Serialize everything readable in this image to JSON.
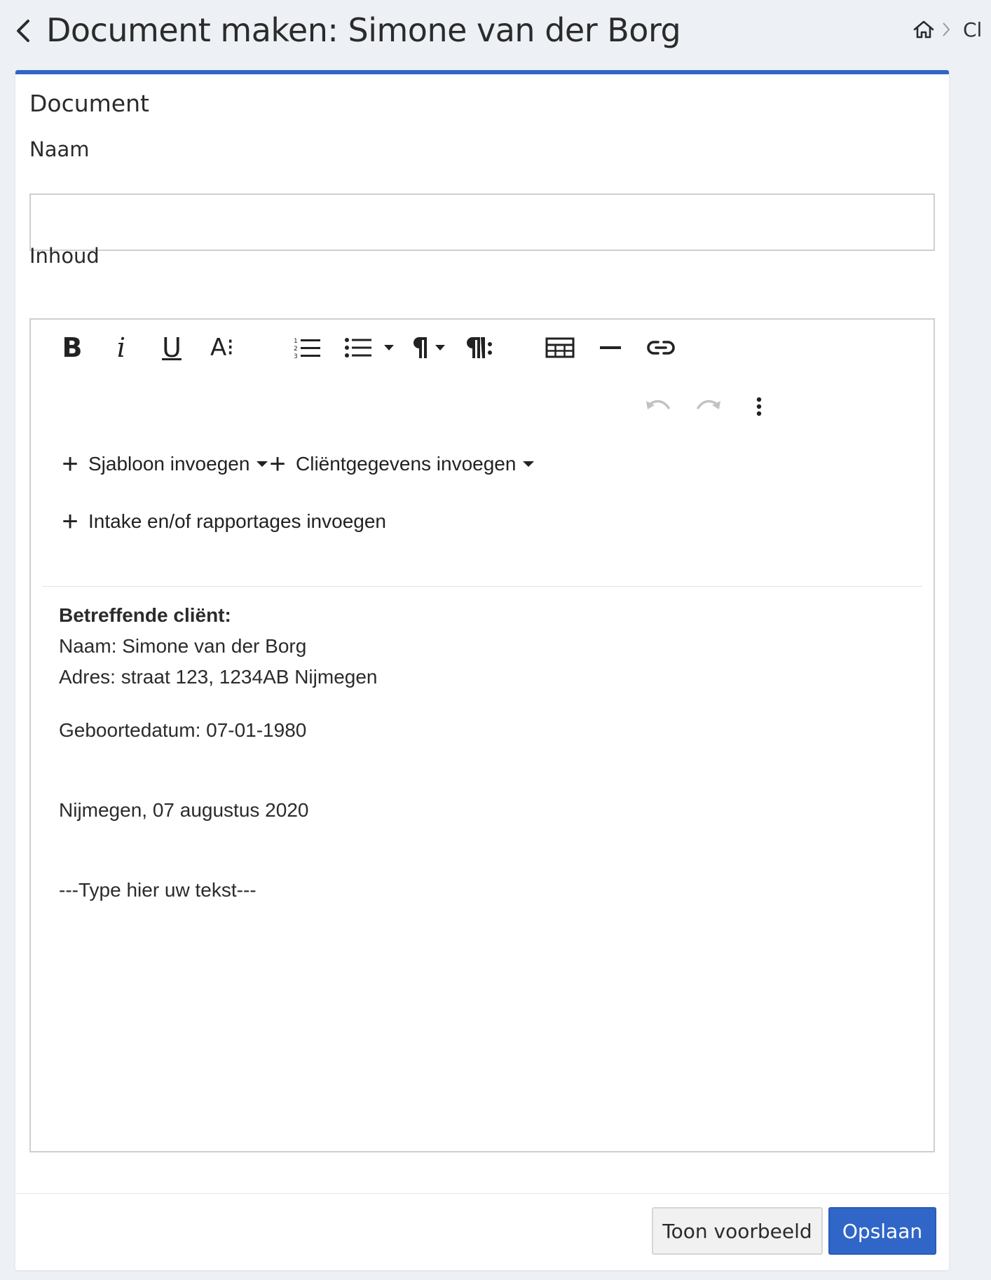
{
  "header": {
    "title": "Document maken: Simone van der Borg",
    "breadcrumb_item": "Cl"
  },
  "card": {
    "title": "Document",
    "name_label": "Naam",
    "name_value": "",
    "content_label": "Inhoud"
  },
  "toolbar": {
    "bold": "B",
    "italic": "i",
    "underline": "U",
    "font_size": "A⁝",
    "insert_template": "Sjabloon invoegen",
    "insert_client_data": "Cliëntgegevens invoegen",
    "insert_intake": "Intake en/of rapportages invoegen"
  },
  "document": {
    "heading": "Betreffende cliënt:",
    "line_name": "Naam: Simone van der Borg",
    "line_address": "Adres: straat 123, 1234AB Nijmegen",
    "line_birthdate": "Geboortedatum: 07-01-1980",
    "line_place_date": "Nijmegen, 07 augustus 2020",
    "line_placeholder": "---Type hier uw tekst---"
  },
  "footer": {
    "preview_label": "Toon voorbeeld",
    "save_label": "Opslaan"
  },
  "colors": {
    "accent": "#2f66c7",
    "background": "#edf0f5"
  },
  "icons": [
    "chevron-left-icon",
    "home-icon",
    "chevron-right-icon",
    "numbered-list-icon",
    "bullet-list-icon",
    "paragraph-icon",
    "paragraph-format-icon",
    "table-icon",
    "horizontal-line-icon",
    "link-icon",
    "undo-icon",
    "redo-icon",
    "more-vertical-icon",
    "plus-icon",
    "caret-down-icon"
  ]
}
